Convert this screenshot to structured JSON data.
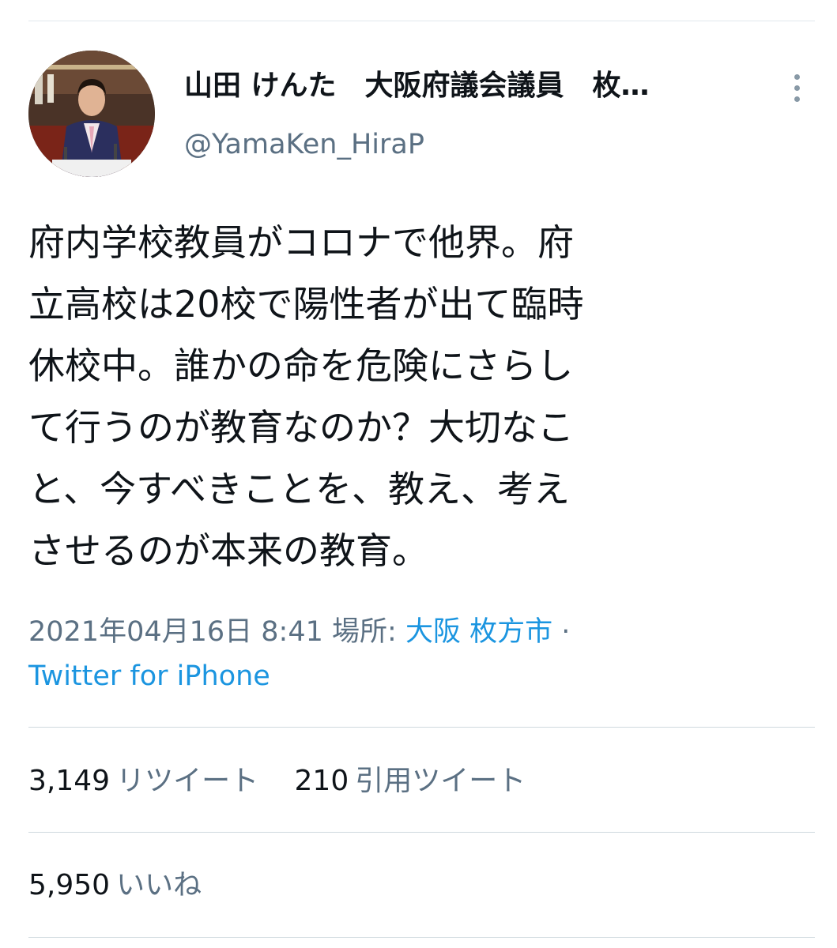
{
  "author": {
    "display_name": "山田 けんた　大阪府議会議員　枚…",
    "handle": "@YamaKen_HiraP",
    "avatar_icon": "profile-photo-speaker-at-podium"
  },
  "more_icon": "more-vertical-icon",
  "tweet": {
    "text": "府内学校教員がコロナで他界。府\n立高校は20校で陽性者が出て臨時\n休校中。誰かの命を危険にさらし\nて行うのが教育なのか？大切なこ\nと、今すべきことを、教え、考え\nさせるのが本来の教育。"
  },
  "meta": {
    "datetime": "2021年04月16日 8:41",
    "location_label": "場所:",
    "location": "大阪 枚方市",
    "separator": "·",
    "source": "Twitter for iPhone"
  },
  "stats": {
    "retweets": {
      "count": "3,149",
      "label": "リツイート"
    },
    "quotes": {
      "count": "210",
      "label": "引用ツイート"
    },
    "likes": {
      "count": "5,950",
      "label": "いいね"
    }
  },
  "colors": {
    "text": "#0f1419",
    "secondary": "#5b7083",
    "link": "#1b95e0",
    "divider": "#cfd9de"
  }
}
